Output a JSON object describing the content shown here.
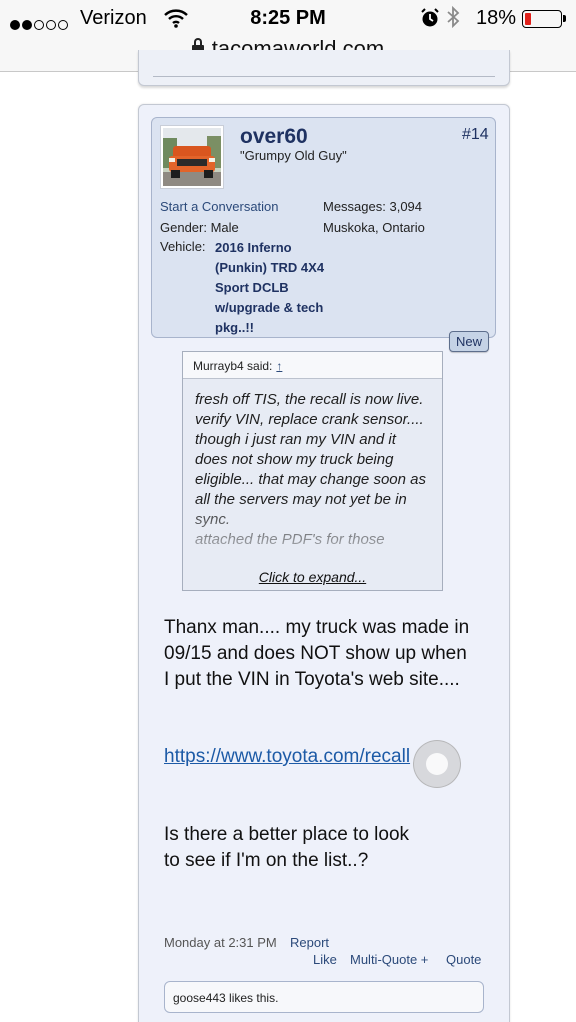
{
  "status_bar": {
    "carrier": "Verizon",
    "time": "8:25 PM",
    "battery_pct": "18%",
    "battery_level": 0.18,
    "battery_color": "#e0211b",
    "icons": [
      "signal-icon",
      "wifi-icon",
      "alarm-icon",
      "bluetooth-icon",
      "battery-icon"
    ]
  },
  "browser": {
    "url": "tacomaworld.com",
    "icons": [
      "lock-icon"
    ]
  },
  "post": {
    "username": "over60",
    "user_title": "\"Grumpy Old Guy\"",
    "post_number": "#14",
    "start_conversation": "Start a Conversation",
    "gender": "Gender: Male",
    "vehicle_label": "Vehicle:",
    "vehicle_value": "2016 Inferno (Punkin) TRD 4X4 Sport DCLB w/upgrade & tech pkg..!!",
    "messages": "Messages: 3,094",
    "location": "Muskoka, Ontario",
    "new_badge": "New",
    "quote": {
      "author_said": "Murrayb4 said:",
      "arrow": "↑",
      "text": "fresh off TIS, the recall is now live.\nverify VIN, replace crank sensor.... though i just ran my VIN and it does not show my truck being eligible... that may change soon as all the servers may not yet be in sync.\nattached the PDF's for those",
      "expand": "Click to expand..."
    },
    "message_1": "Thanx man.... my truck was made in 09/15 and does NOT show up when I put the VIN in Toyota's web site....",
    "message_link": "https://www.toyota.com/recall",
    "message_2": "Is there a better place to look to see if I'm on the list..?",
    "timestamp": "Monday at 2:31 PM",
    "report": "Report",
    "like": "Like",
    "multi_quote": "Multi-Quote +",
    "quote_link": "Quote",
    "likes_summary": "goose443 likes this."
  },
  "colors": {
    "username": "#1f3262",
    "link": "#1c5aa6",
    "userinfo_bg": "#dbe3f1",
    "post_bg": "#eef1fa"
  }
}
